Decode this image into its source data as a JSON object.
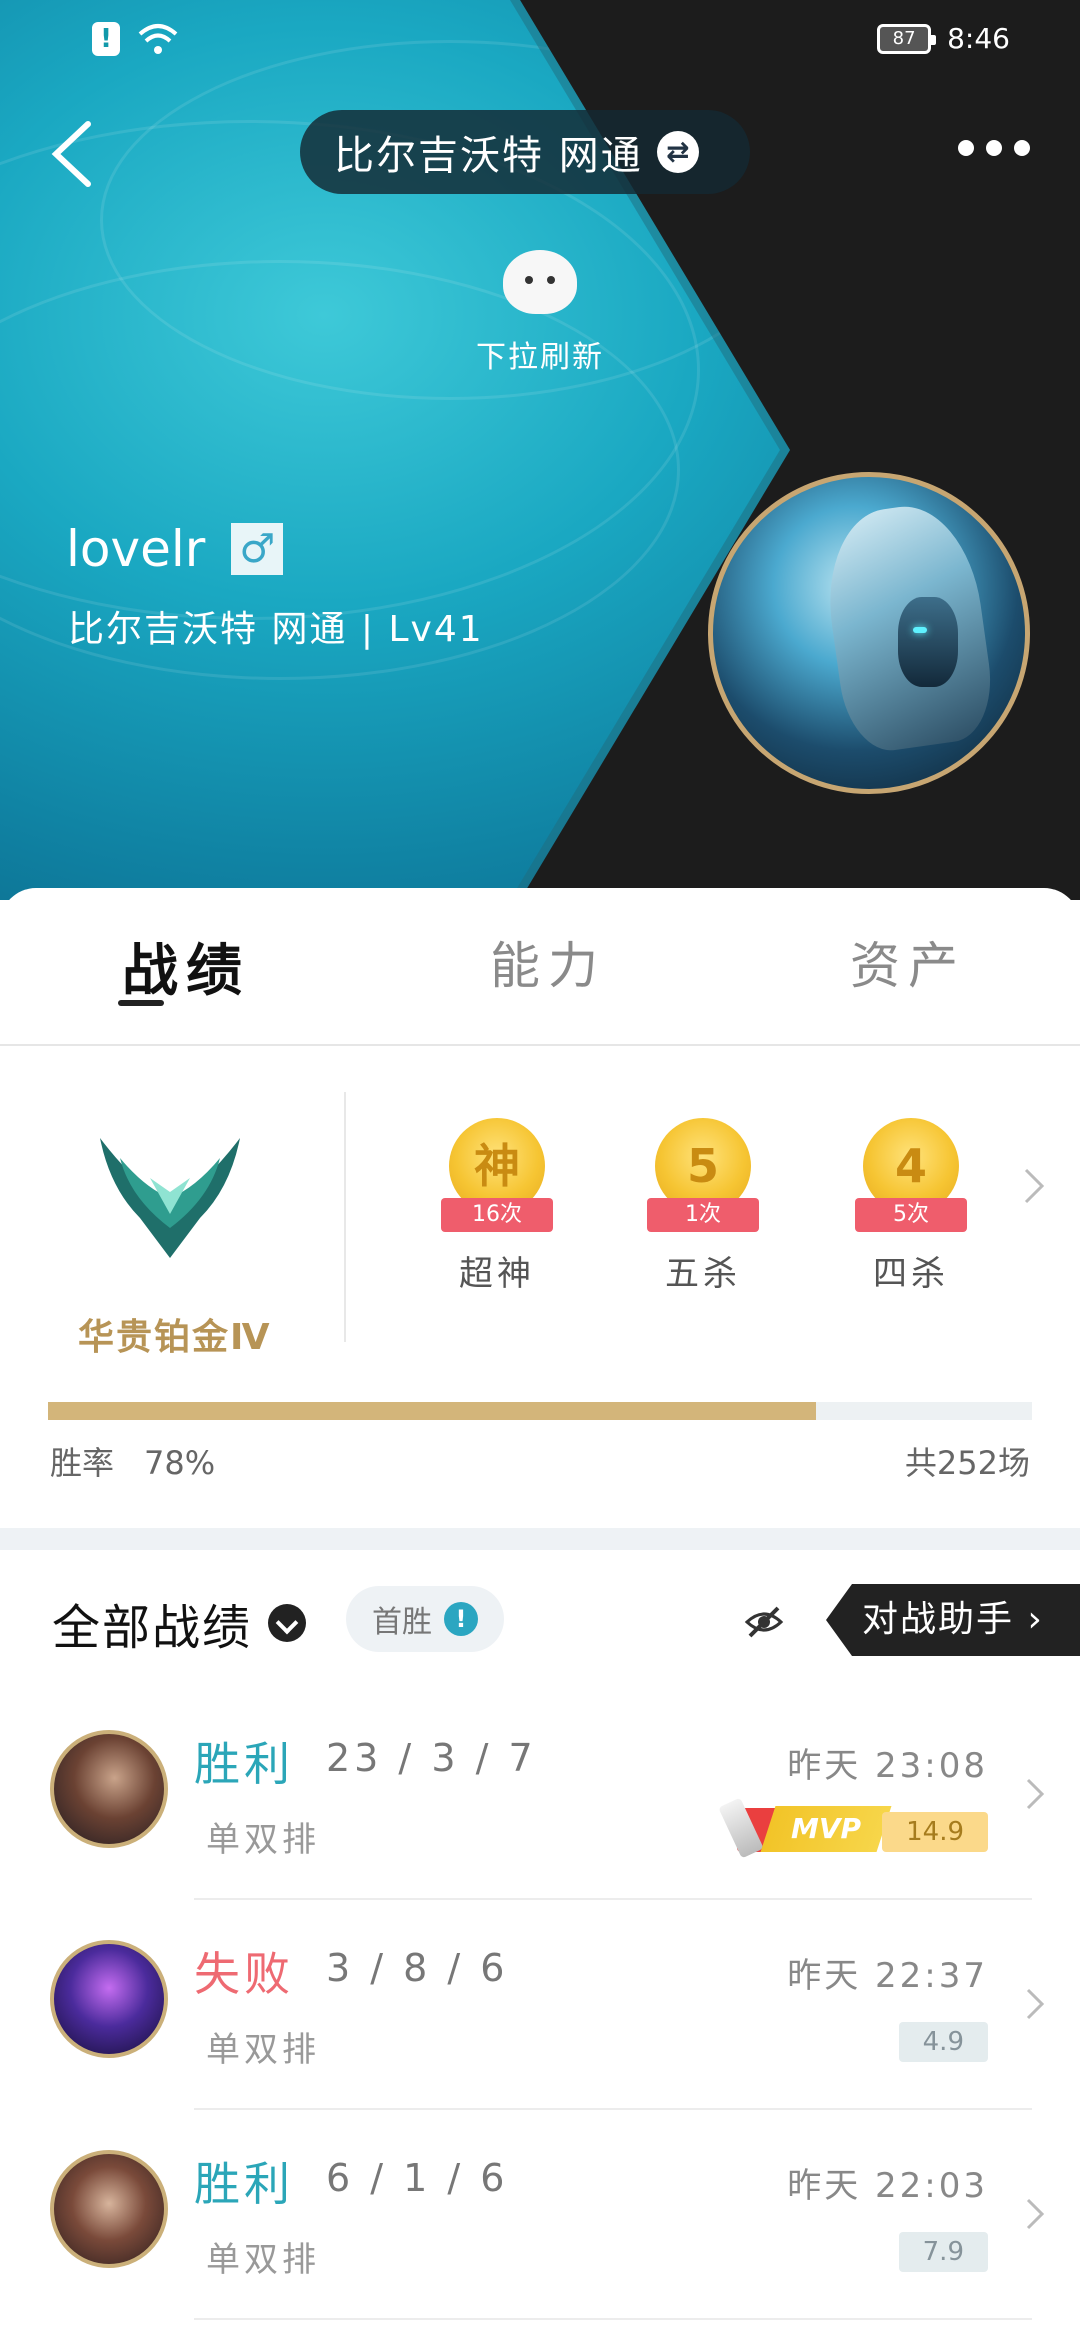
{
  "status": {
    "battery": "87",
    "time": "8:46"
  },
  "header": {
    "title": "比尔吉沃特  网通"
  },
  "pull_refresh": "下拉刷新",
  "profile": {
    "name": "lovelr",
    "server_level": "比尔吉沃特  网通  |  Lv41"
  },
  "tabs": [
    "战绩",
    "能力",
    "资产"
  ],
  "rank": {
    "name": "华贵铂金Ⅳ"
  },
  "badges": [
    {
      "glyph": "神",
      "count": "16次",
      "label": "超神"
    },
    {
      "glyph": "5",
      "count": "1次",
      "label": "五杀"
    },
    {
      "glyph": "4",
      "count": "5次",
      "label": "四杀"
    }
  ],
  "winrate": {
    "label": "胜率",
    "value": "78%",
    "fraction": 0.78,
    "total": "共252场"
  },
  "list": {
    "title": "全部战绩",
    "filter": "首胜",
    "assist": "对战助手"
  },
  "matches": [
    {
      "result": "胜利",
      "kda": "23 / 3 / 7",
      "mode": "单双排",
      "time": "昨天  23:08",
      "score": "14.9",
      "tags": {
        "penta": "5杀",
        "mvp": "MVP"
      }
    },
    {
      "result": "失败",
      "kda": "3 / 8 / 6",
      "mode": "单双排",
      "time": "昨天  22:37",
      "score": "4.9"
    },
    {
      "result": "胜利",
      "kda": "6 / 1 / 6",
      "mode": "单双排",
      "time": "昨天  22:03",
      "score": "7.9"
    }
  ],
  "colors": {
    "teal": "#2ba6b8",
    "win": "#2ba6b8",
    "lose": "#ee6a72",
    "gold": "#d3b57a"
  }
}
